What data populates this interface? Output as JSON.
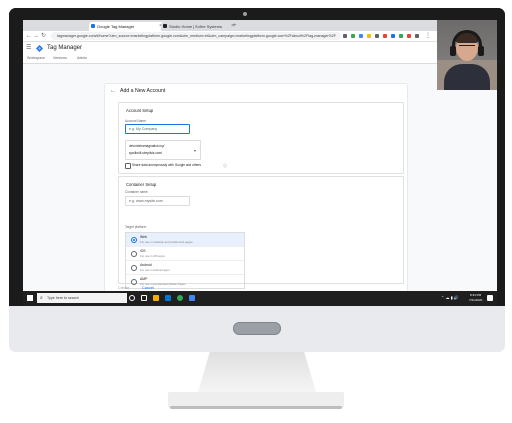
{
  "browser": {
    "tabs": [
      {
        "label": "Google Tag Manager",
        "active": true
      },
      {
        "label": "Studio Home | Ezfire Systems"
      }
    ],
    "new_tab_symbol": "+",
    "url": "tagmanager.google.com/#/home?utm_source=marketingplatform.google.com&utm_medium=et&utm_campaign=marketingplatform.google.com%2Fabout%2Ftag-manager%2F"
  },
  "app": {
    "title": "Tag Manager",
    "tabs": [
      "Workspace",
      "Versions",
      "Admin"
    ]
  },
  "panel": {
    "back_icon": "arrow-left-icon",
    "title": "Add a New Account",
    "account_setup": {
      "title": "Account Setup",
      "account_name_label": "Account Name",
      "account_name_placeholder": "e.g. My Company",
      "country_lines": [
        "devonteiramagnatics.my/",
        "spoilbuilt.simplisis.com/"
      ],
      "share_label": "Share data anonymously with Google and others",
      "help_icon": "help-circle-icon"
    },
    "container_setup": {
      "title": "Container Setup",
      "container_name_label": "Container name",
      "container_name_placeholder": "e.g. www.mysite.com",
      "target_platform_label": "Target platform",
      "platforms": [
        {
          "name": "Web",
          "desc": "For use on desktop and mobile web pages",
          "selected": true
        },
        {
          "name": "iOS",
          "desc": "For use in iOS apps",
          "selected": false
        },
        {
          "name": "Android",
          "desc": "For use in Android apps",
          "selected": false
        },
        {
          "name": "AMP",
          "desc": "For use in Accelerated Mobile Pages",
          "selected": false
        }
      ]
    },
    "buttons": {
      "create": "Create",
      "cancel": "Cancel"
    }
  },
  "taskbar": {
    "search_placeholder": "Type here to search",
    "time": "8:34 PM",
    "date": "7/21/2020"
  },
  "colors": {
    "accent": "#1a73e8",
    "taskbar": "#1f1f1f",
    "bezel": "#1b1b1b"
  }
}
